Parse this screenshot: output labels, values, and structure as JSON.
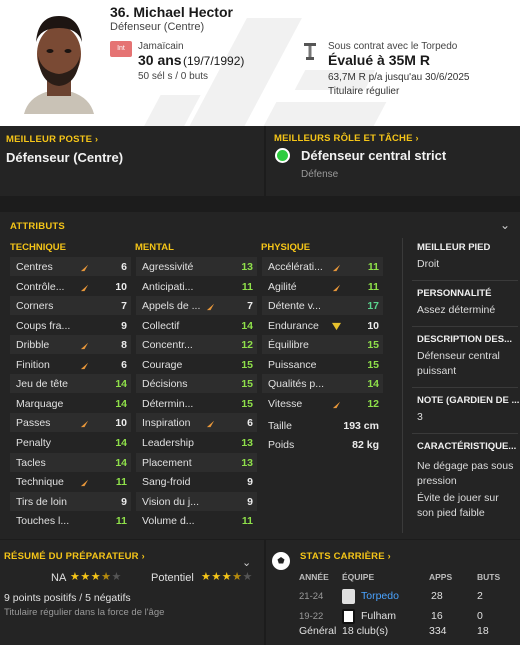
{
  "player": {
    "number_name": "36. Michael Hector",
    "position": "Défenseur (Centre)",
    "flag_label": "Int",
    "nationality": "Jamaïcain",
    "age": "30 ans",
    "dob": "(19/7/1992)",
    "caps": "50 sél s / 0 buts",
    "contract": "Sous contrat avec le Torpedo",
    "value": "Évalué à 35M R",
    "wage": "63,7M R p/a jusqu'au 30/6/2025",
    "squad_status": "Titulaire régulier"
  },
  "best_position": {
    "title": "MEILLEUR POSTE",
    "value": "Défenseur (Centre)"
  },
  "best_role": {
    "title": "MEILLEURS RÔLE ET TÂCHE",
    "role": "Défenseur central strict",
    "duty": "Défense",
    "dot_color": "#2ecc40"
  },
  "attributes": {
    "title": "ATTRIBUTS",
    "technical_header": "TECHNIQUE",
    "mental_header": "MENTAL",
    "physical_header": "PHYSIQUE",
    "technical": [
      {
        "name": "Centres",
        "value": "6",
        "arrow": "up"
      },
      {
        "name": "Contrôle...",
        "value": "10",
        "arrow": "up"
      },
      {
        "name": "Corners",
        "value": "7",
        "arrow": ""
      },
      {
        "name": "Coups fra...",
        "value": "9",
        "arrow": ""
      },
      {
        "name": "Dribble",
        "value": "8",
        "arrow": "up"
      },
      {
        "name": "Finition",
        "value": "6",
        "arrow": "up"
      },
      {
        "name": "Jeu de tête",
        "value": "14",
        "arrow": ""
      },
      {
        "name": "Marquage",
        "value": "14",
        "arrow": ""
      },
      {
        "name": "Passes",
        "value": "10",
        "arrow": "up"
      },
      {
        "name": "Penalty",
        "value": "14",
        "arrow": ""
      },
      {
        "name": "Tacles",
        "value": "14",
        "arrow": ""
      },
      {
        "name": "Technique",
        "value": "11",
        "arrow": "up"
      },
      {
        "name": "Tirs de loin",
        "value": "9",
        "arrow": ""
      },
      {
        "name": "Touches l...",
        "value": "11",
        "arrow": ""
      }
    ],
    "mental": [
      {
        "name": "Agressivité",
        "value": "13",
        "arrow": ""
      },
      {
        "name": "Anticipati...",
        "value": "11",
        "arrow": ""
      },
      {
        "name": "Appels de ...",
        "value": "7",
        "arrow": "up"
      },
      {
        "name": "Collectif",
        "value": "14",
        "arrow": ""
      },
      {
        "name": "Concentr...",
        "value": "12",
        "arrow": ""
      },
      {
        "name": "Courage",
        "value": "15",
        "arrow": ""
      },
      {
        "name": "Décisions",
        "value": "15",
        "arrow": ""
      },
      {
        "name": "Détermin...",
        "value": "15",
        "arrow": ""
      },
      {
        "name": "Inspiration",
        "value": "6",
        "arrow": "up"
      },
      {
        "name": "Leadership",
        "value": "13",
        "arrow": ""
      },
      {
        "name": "Placement",
        "value": "13",
        "arrow": ""
      },
      {
        "name": "Sang-froid",
        "value": "9",
        "arrow": ""
      },
      {
        "name": "Vision du j...",
        "value": "9",
        "arrow": ""
      },
      {
        "name": "Volume d...",
        "value": "11",
        "arrow": ""
      }
    ],
    "physical": [
      {
        "name": "Accélérati...",
        "value": "11",
        "arrow": "up"
      },
      {
        "name": "Agilité",
        "value": "11",
        "arrow": "up"
      },
      {
        "name": "Détente v...",
        "value": "17",
        "arrow": ""
      },
      {
        "name": "Endurance",
        "value": "10",
        "arrow": "down"
      },
      {
        "name": "Équilibre",
        "value": "15",
        "arrow": ""
      },
      {
        "name": "Puissance",
        "value": "15",
        "arrow": ""
      },
      {
        "name": "Qualités p...",
        "value": "14",
        "arrow": ""
      },
      {
        "name": "Vitesse",
        "value": "12",
        "arrow": "up"
      }
    ],
    "height_label": "Taille",
    "height_value": "193 cm",
    "weight_label": "Poids",
    "weight_value": "82 kg"
  },
  "side": {
    "foot_title": "MEILLEUR PIED",
    "foot_value": "Droit",
    "personality_title": "PERSONNALITÉ",
    "personality_value": "Assez déterminé",
    "description_title": "DESCRIPTION DES...",
    "description_value": "Défenseur central puissant",
    "rating_title": "NOTE (GARDIEN DE ...",
    "rating_value": "3",
    "traits_title": "CARACTÉRISTIQUE...",
    "trait_1": "Ne dégage pas sous pression",
    "trait_2": "Évite de jouer sur son pied faible"
  },
  "coach_report": {
    "title": "RÉSUMÉ DU PRÉPARATEUR",
    "ca_label": "NA",
    "pa_label": "Potentiel",
    "ca_stars": 3.5,
    "pa_stars": 3.5,
    "summary": "9 points positifs / 5 négatifs",
    "status": "Titulaire régulier dans la force de l'âge"
  },
  "career": {
    "title": "STATS CARRIÈRE",
    "headers": [
      "ANNÉE",
      "ÉQUIPE",
      "APPS",
      "BUTS"
    ],
    "rows": [
      {
        "year": "21-24",
        "club": "Torpedo",
        "apps": "28",
        "goals": "2"
      },
      {
        "year": "19-22",
        "club": "Fulham",
        "apps": "16",
        "goals": "0"
      }
    ],
    "total_label": "Général",
    "total_clubs": "18 club(s)",
    "total_apps": "334",
    "total_goals": "18"
  },
  "colors": {
    "gold": "#f5c518",
    "arrow_up": "#e8973a",
    "arrow_down": "#e6c12d",
    "link": "#4aa3ff"
  }
}
